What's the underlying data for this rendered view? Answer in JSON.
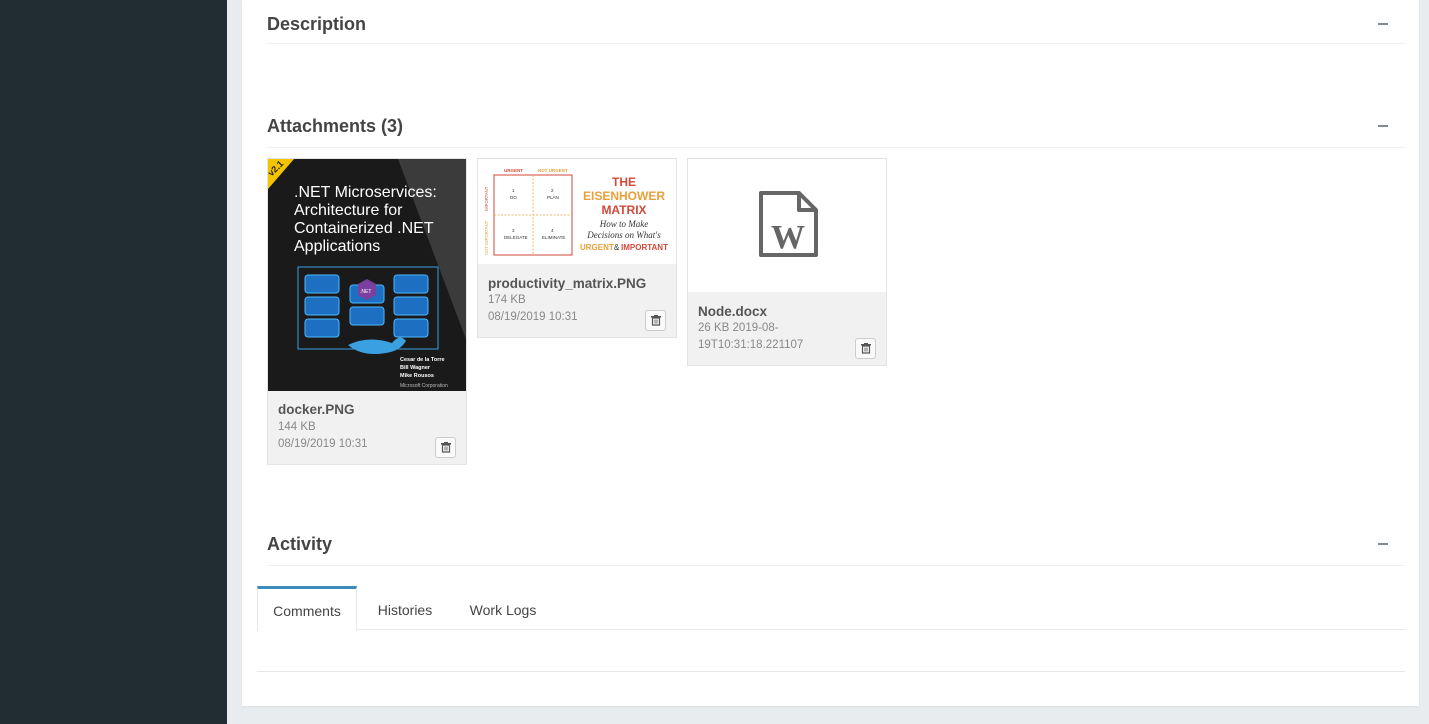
{
  "sections": {
    "description": {
      "title": "Description"
    },
    "attachments": {
      "title": "Attachments (3)"
    },
    "activity": {
      "title": "Activity"
    }
  },
  "attachments": [
    {
      "name": "docker.PNG",
      "size": "144 KB",
      "date": "08/19/2019 10:31",
      "thumb_text": {
        "badge": "v2.1",
        "title": ".NET Microservices: Architecture for Containerized .NET Applications",
        "authors": [
          "Cesar de la Torre",
          "Bill Wagner",
          "Mike Rousos"
        ],
        "publisher": "Microsoft Corporation",
        "net_label": ".NET"
      }
    },
    {
      "name": "productivity_matrix.PNG",
      "size": "174 KB",
      "date": "08/19/2019 10:31",
      "thumb_text": {
        "urgent": "URGENT",
        "not_urgent": "NOT URGENT",
        "important": "IMPORTANT",
        "not_important": "NOT IMPORTANT",
        "q1": "1",
        "q1_label": "DO",
        "q2": "2",
        "q2_label": "PLAN",
        "q3": "3",
        "q3_label": "DELEGATE",
        "q4": "4",
        "q4_label": "ELIMINATE",
        "heading1": "THE",
        "heading2": "EISENHOWER",
        "heading3": "MATRIX",
        "sub1": "How to Make",
        "sub2": "Decisions on What's",
        "sub3a": "URGENT",
        "sub3b": "&",
        "sub3c": "IMPORTANT"
      }
    },
    {
      "name": "Node.docx",
      "size_line": "26 KB 2019-08-",
      "date_line": "19T10:31:18.221107",
      "icon": "word-file-icon"
    }
  ],
  "tabs": [
    {
      "label": "Comments",
      "active": true
    },
    {
      "label": "Histories",
      "active": false
    },
    {
      "label": "Work Logs",
      "active": false
    }
  ],
  "colors": {
    "sidebar": "#222d33",
    "accent": "#3c8dbc",
    "docker_bg": "#1a1a1a",
    "matrix_orange": "#e8a03a",
    "matrix_red": "#d24a3a"
  }
}
